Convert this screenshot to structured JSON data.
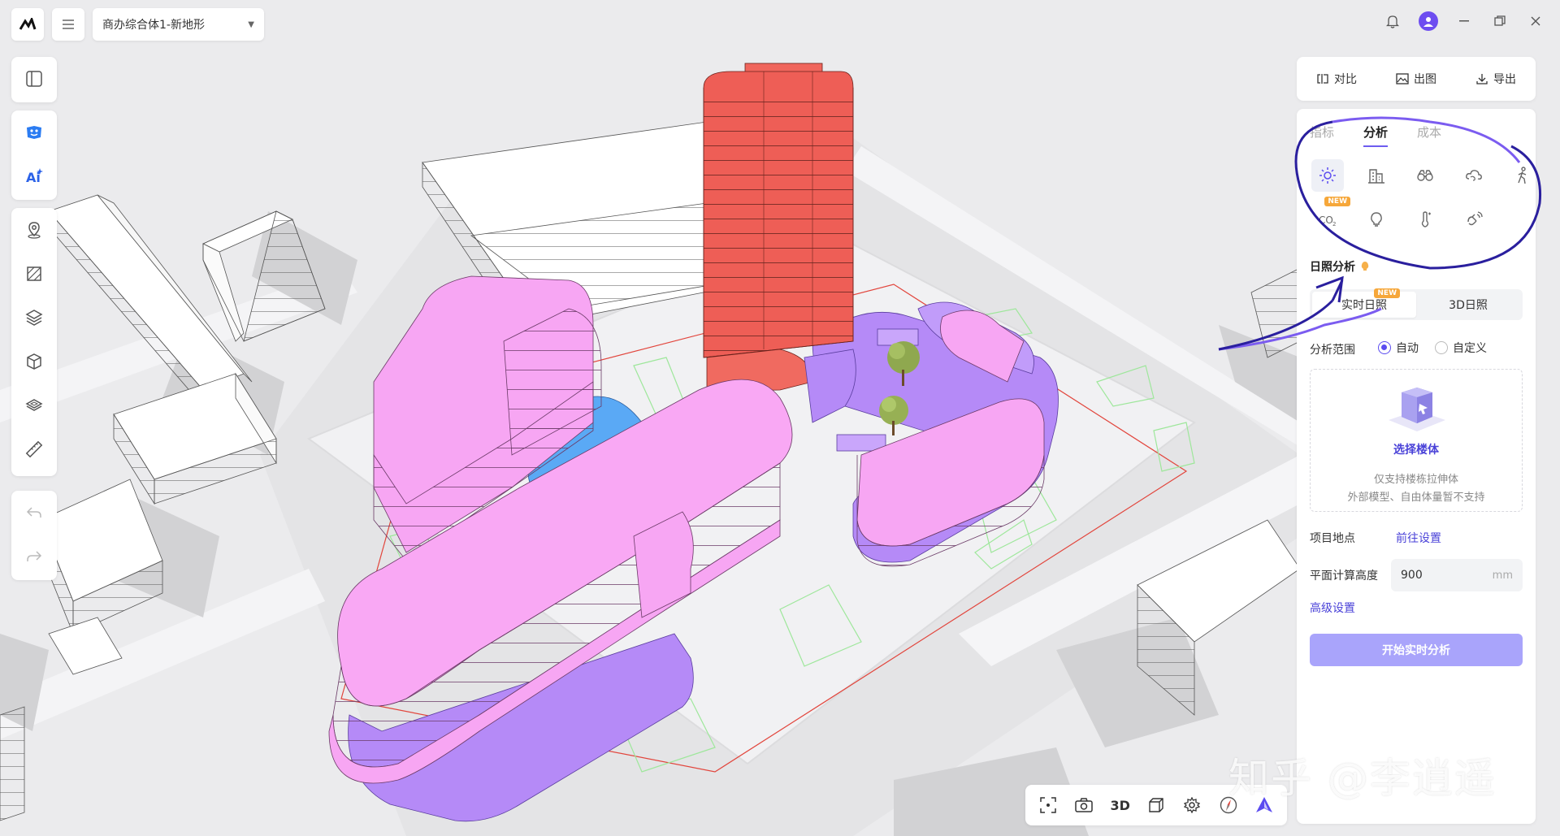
{
  "topbar": {
    "project_name": "商办综合体1-新地形",
    "logo_icon": "logo-icon",
    "menu_icon": "hamburger-icon",
    "right_icons": [
      "bell-icon",
      "user-avatar",
      "minimize-icon",
      "restore-icon",
      "close-icon"
    ]
  },
  "left_toolbar": {
    "group1": [
      "panel-toggle-icon"
    ],
    "group2": [
      "ai-ideas-icon",
      "ai-generate-icon"
    ],
    "group3": [
      "location-pin-icon",
      "hatch-area-icon",
      "layers-icon",
      "box-model-icon",
      "slab-icon",
      "ruler-icon"
    ],
    "group4": [
      "undo-icon",
      "redo-icon"
    ]
  },
  "right_panel": {
    "top_actions": [
      {
        "label": "对比",
        "icon": "compare-icon"
      },
      {
        "label": "出图",
        "icon": "image-export-icon"
      },
      {
        "label": "导出",
        "icon": "download-icon"
      }
    ],
    "tabs": [
      {
        "label": "指标",
        "active": false
      },
      {
        "label": "分析",
        "active": true
      },
      {
        "label": "成本",
        "active": false
      }
    ],
    "analysis_icons": [
      {
        "name": "sun-icon",
        "selected": true
      },
      {
        "name": "building-icon",
        "selected": false
      },
      {
        "name": "binoculars-icon",
        "selected": false
      },
      {
        "name": "wind-icon",
        "selected": false
      },
      {
        "name": "walking-person-icon",
        "selected": false
      },
      {
        "name": "co2-icon",
        "selected": false,
        "badge": "NEW"
      },
      {
        "name": "bulb-icon",
        "selected": false
      },
      {
        "name": "thermometer-icon",
        "selected": false
      },
      {
        "name": "wave-hand-icon",
        "selected": false
      }
    ],
    "section_title": "日照分析",
    "segment": [
      {
        "label": "实时日照",
        "active": true,
        "badge": "NEW"
      },
      {
        "label": "3D日照",
        "active": false
      }
    ],
    "range_label": "分析范围",
    "range_options": [
      {
        "label": "自动",
        "checked": true
      },
      {
        "label": "自定义",
        "checked": false
      }
    ],
    "pick": {
      "link": "选择楼体",
      "hint1": "仅支持楼栋拉伸体",
      "hint2": "外部模型、自由体量暂不支持"
    },
    "location_label": "项目地点",
    "location_link": "前往设置",
    "height_label": "平面计算高度",
    "height_value": "900",
    "height_unit": "mm",
    "advanced_link": "高级设置",
    "start_button": "开始实时分析"
  },
  "bottom_toolbar": {
    "items": [
      "focus-icon",
      "camera-icon",
      "3D",
      "cube-view-icon",
      "settings-icon",
      "compass-icon",
      "navigate-icon"
    ]
  },
  "watermark": "知乎 @李逍遥",
  "colors": {
    "accent": "#5b4cf0",
    "tower": "#ef5d55",
    "podium_pink": "#f9a8f4",
    "podium_purple": "#b88af8",
    "annex_blue": "#5aa9f5"
  }
}
